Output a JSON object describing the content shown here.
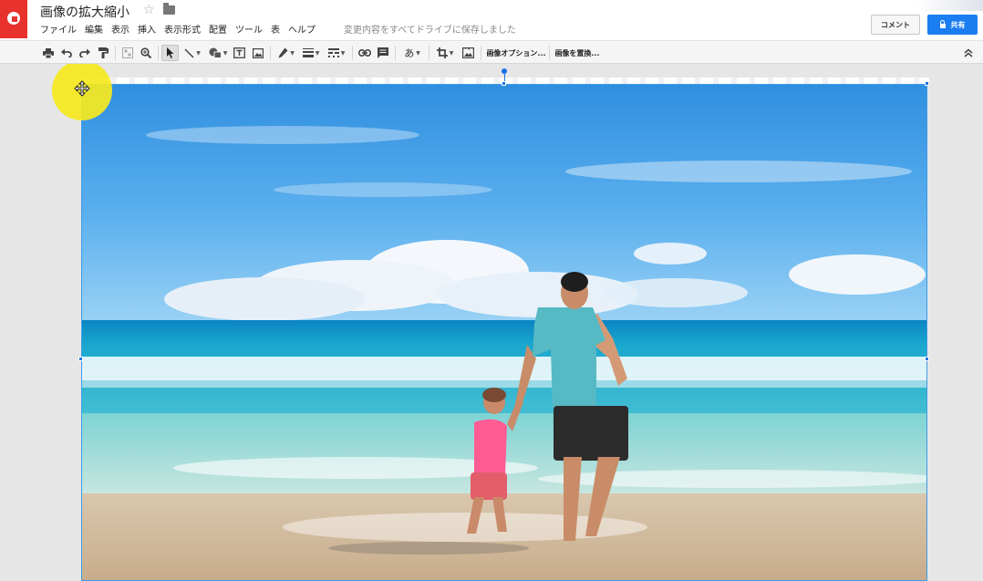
{
  "app": {
    "document_title": "画像の拡大縮小",
    "save_status": "変更内容をすべてドライブに保存しました"
  },
  "menu": {
    "items": [
      {
        "label": "ファイル"
      },
      {
        "label": "編集"
      },
      {
        "label": "表示"
      },
      {
        "label": "挿入"
      },
      {
        "label": "表示形式"
      },
      {
        "label": "配置"
      },
      {
        "label": "ツール"
      },
      {
        "label": "表"
      },
      {
        "label": "ヘルプ"
      }
    ]
  },
  "header_buttons": {
    "comment_label": "コメント",
    "share_label": "共有"
  },
  "toolbar": {
    "text_style_label": "あ",
    "image_options_label": "画像オプション...",
    "replace_image_label": "画像を置換..."
  },
  "icons": {
    "logo": "drawings-logo",
    "star": "star-outline-icon",
    "folder": "folder-icon",
    "print": "print-icon",
    "undo": "undo-icon",
    "redo": "redo-icon",
    "paint_format": "paint-format-icon",
    "snap": "snap-to-grid-icon",
    "zoom": "zoom-icon",
    "select": "select-cursor-icon",
    "line": "line-icon",
    "shape": "shape-icon",
    "textbox": "text-box-icon",
    "image": "image-icon",
    "pen": "border-color-icon",
    "weight": "border-weight-icon",
    "dash": "border-dash-icon",
    "link": "link-icon",
    "comment": "add-comment-icon",
    "crop": "crop-icon",
    "reset": "reset-image-icon",
    "collapse": "collapse-icon",
    "move_cursor": "move-cursor-icon"
  },
  "colors": {
    "brand_red": "#e8322c",
    "share_blue": "#1a7df0",
    "selection_blue": "#1a73e8",
    "cursor_highlight": "#f6e91e"
  }
}
